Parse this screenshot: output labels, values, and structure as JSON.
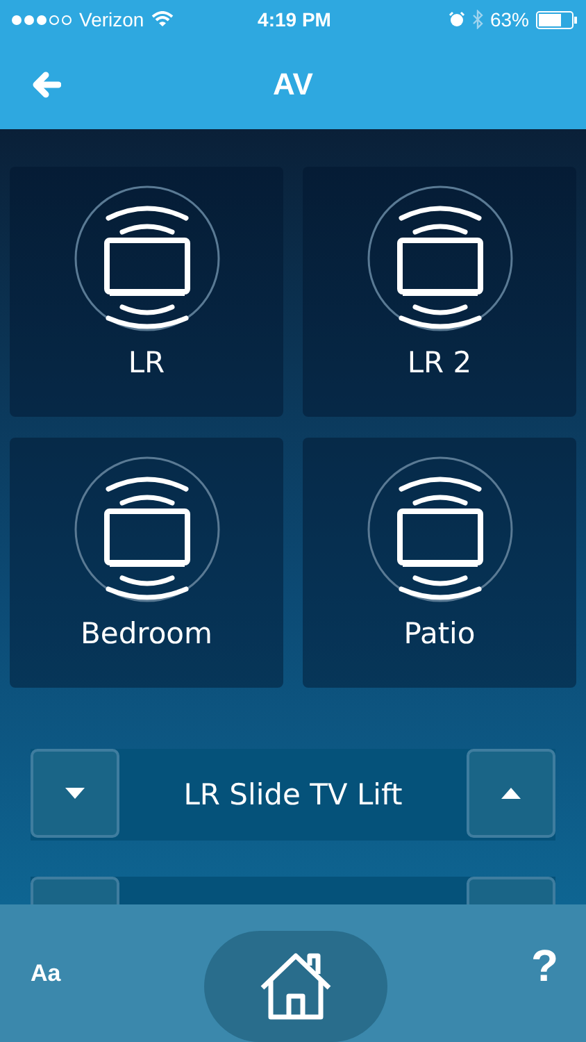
{
  "status_bar": {
    "carrier": "Verizon",
    "time": "4:19 PM",
    "battery": "63%"
  },
  "header": {
    "title": "AV"
  },
  "rooms": [
    {
      "label": "LR"
    },
    {
      "label": "LR 2"
    },
    {
      "label": "Bedroom"
    },
    {
      "label": "Patio"
    }
  ],
  "controls": [
    {
      "label": "LR Slide TV Lift"
    }
  ],
  "footer": {
    "font_button": "Aa",
    "help_button": "?"
  }
}
